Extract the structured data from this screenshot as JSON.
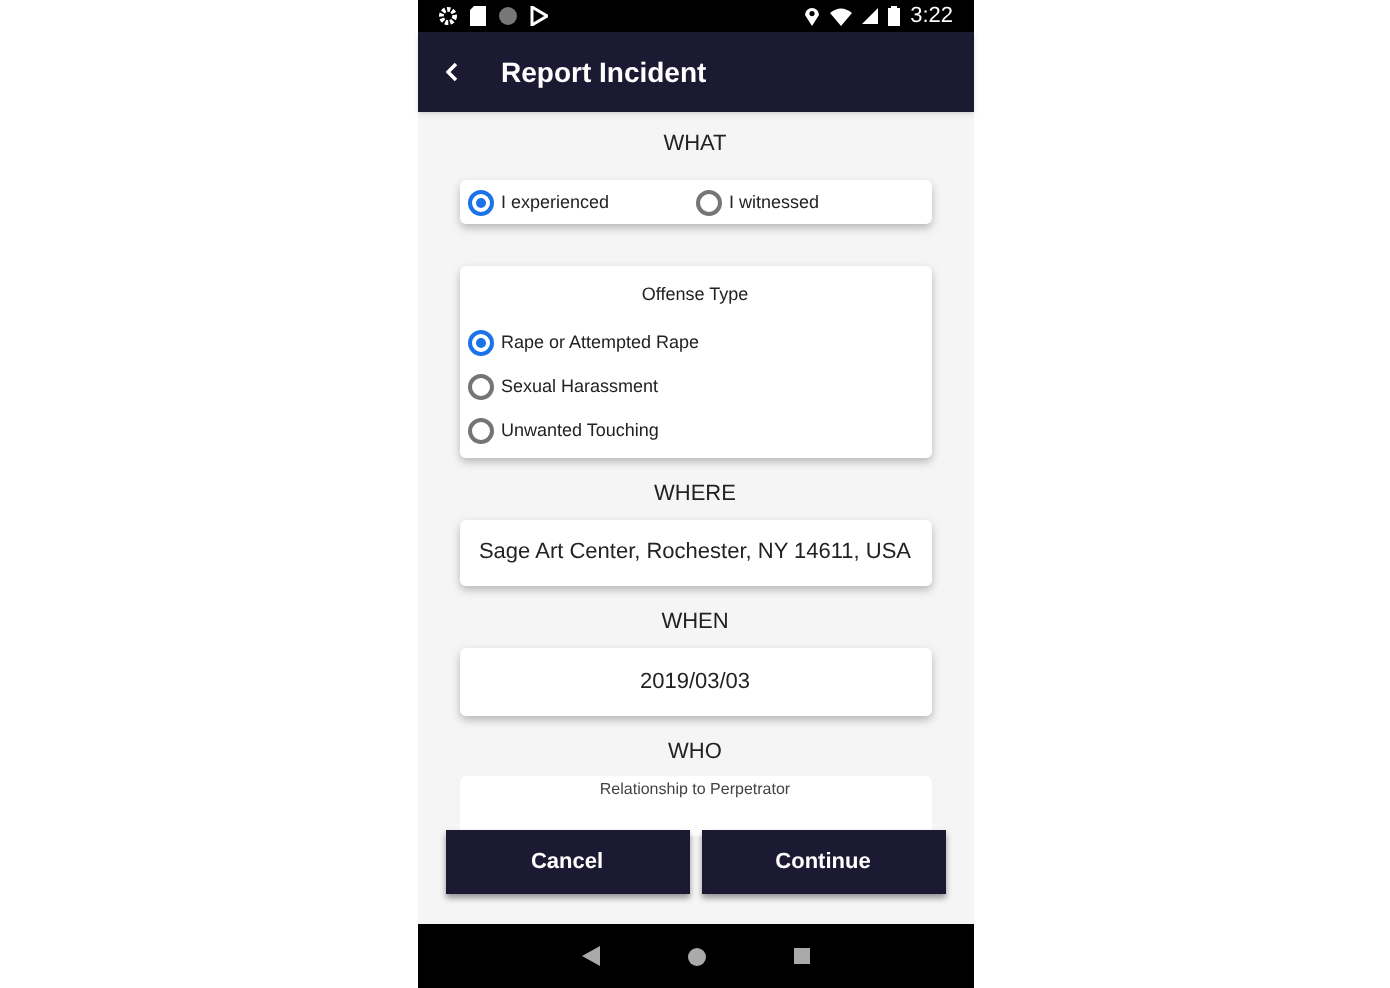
{
  "status_bar": {
    "time": "3:22"
  },
  "app_bar": {
    "title": "Report Incident"
  },
  "what": {
    "heading": "WHAT",
    "options": [
      {
        "label": "I experienced",
        "selected": true
      },
      {
        "label": "I witnessed",
        "selected": false
      }
    ]
  },
  "offense_type": {
    "title": "Offense Type",
    "options": [
      {
        "label": "Rape or Attempted Rape",
        "selected": true
      },
      {
        "label": "Sexual Harassment",
        "selected": false
      },
      {
        "label": "Unwanted Touching",
        "selected": false
      }
    ]
  },
  "where": {
    "heading": "WHERE",
    "value": "Sage Art Center, Rochester, NY 14611, USA"
  },
  "when": {
    "heading": "WHEN",
    "value": "2019/03/03"
  },
  "who": {
    "heading": "WHO",
    "field_label": "Relationship to Perpetrator"
  },
  "buttons": [
    "Cancel",
    "Continue"
  ]
}
